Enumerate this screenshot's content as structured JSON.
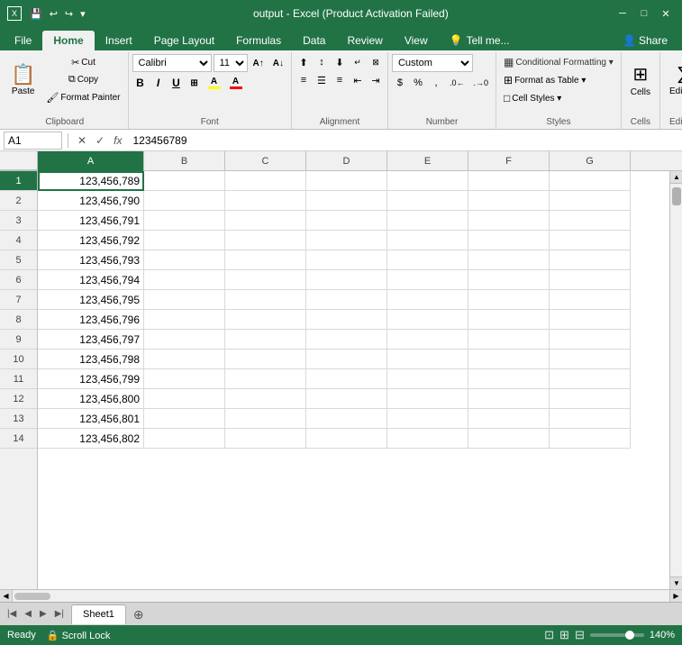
{
  "titleBar": {
    "title": "output - Excel (Product Activation Failed)",
    "saveIcon": "💾",
    "undoIcon": "↩",
    "redoIcon": "↪",
    "minIcon": "─",
    "maxIcon": "□",
    "closeIcon": "✕"
  },
  "tabs": {
    "file": "File",
    "home": "Home",
    "insert": "Insert",
    "pageLayout": "Page Layout",
    "formulas": "Formulas",
    "data": "Data",
    "review": "Review",
    "view": "View",
    "tellMe": "Tell me...",
    "share": "Share"
  },
  "ribbon": {
    "clipboard": {
      "paste": "Paste",
      "cut": "✂",
      "copy": "⧉",
      "formatPainter": "🖌",
      "label": "Clipboard"
    },
    "font": {
      "fontName": "Calibri",
      "fontSize": "11",
      "bold": "B",
      "italic": "I",
      "underline": "U",
      "label": "Font"
    },
    "alignment": {
      "label": "Alignment"
    },
    "number": {
      "format": "Custom",
      "label": "Number"
    },
    "styles": {
      "conditionalFormatting": "Conditional Formatting ▾",
      "formatAsTable": "Format as Table ▾",
      "cellStyles": "Cell Styles ▾",
      "label": "Styles"
    },
    "cells": {
      "label": "Cells",
      "icon": "⊞"
    },
    "editing": {
      "label": "Editing"
    }
  },
  "formulaBar": {
    "cellRef": "A1",
    "cancelBtn": "✕",
    "confirmBtn": "✓",
    "fxBtn": "fx",
    "value": "123456789"
  },
  "columns": [
    "A",
    "B",
    "C",
    "D",
    "E",
    "F",
    "G"
  ],
  "rows": [
    1,
    2,
    3,
    4,
    5,
    6,
    7,
    8,
    9,
    10,
    11,
    12,
    13,
    14
  ],
  "cells": {
    "A1": "123,456,789",
    "A2": "123,456,790",
    "A3": "123,456,791",
    "A4": "123,456,792",
    "A5": "123,456,793",
    "A6": "123,456,794",
    "A7": "123,456,795",
    "A8": "123,456,796",
    "A9": "123,456,797",
    "A10": "123,456,798",
    "A11": "123,456,799",
    "A12": "123,456,800",
    "A13": "123,456,801",
    "A14": "123,456,802"
  },
  "statusBar": {
    "ready": "Ready",
    "scrollLock": "Scroll Lock",
    "zoom": "140%"
  },
  "sheets": {
    "active": "Sheet1",
    "tabs": [
      "Sheet1"
    ]
  }
}
